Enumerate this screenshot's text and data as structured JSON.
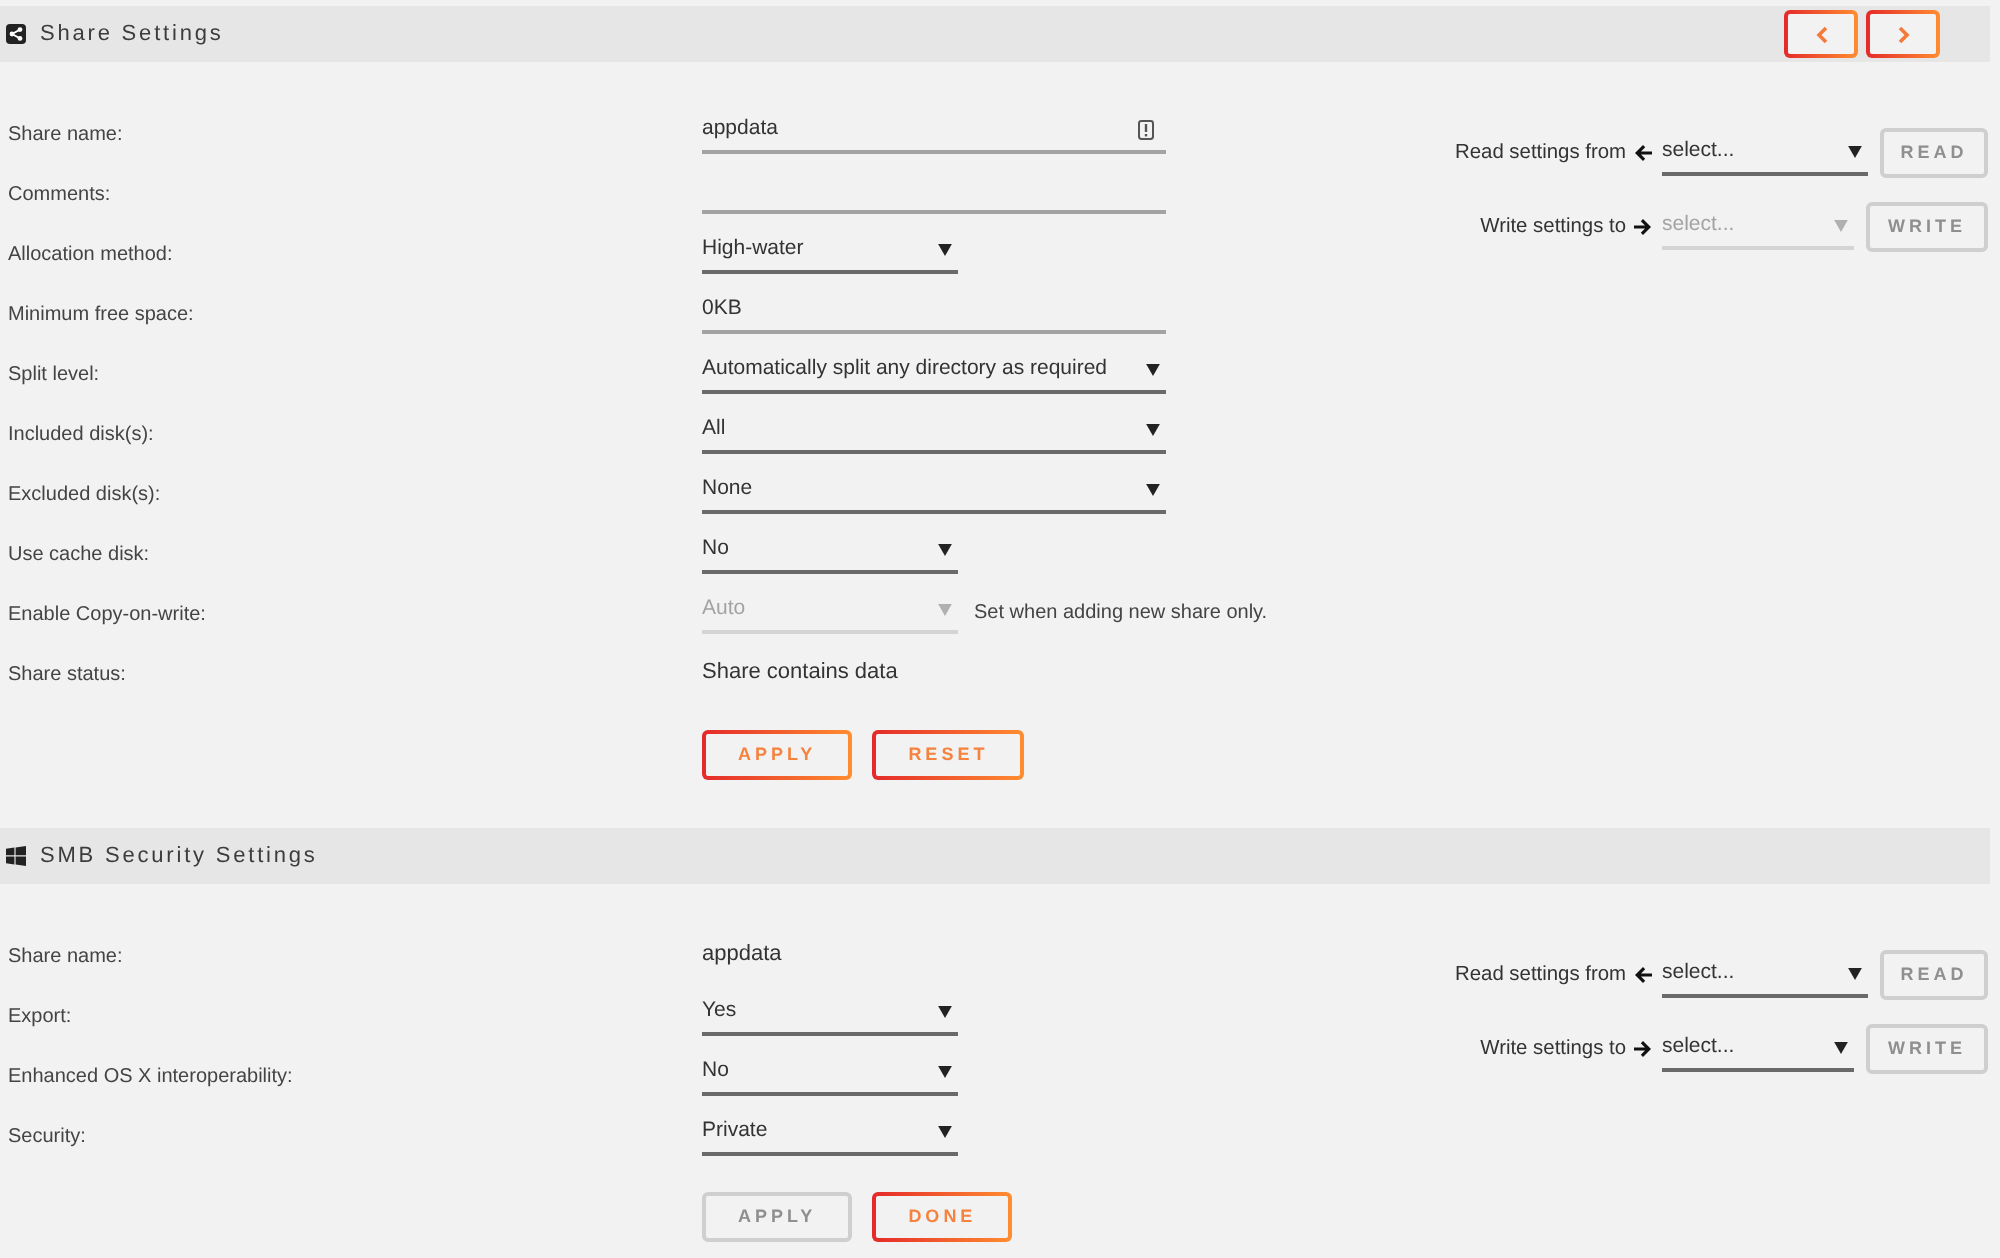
{
  "sections": [
    {
      "kind": "share",
      "title": "Share Settings",
      "nav_buttons": true,
      "fields": [
        {
          "kind": "input",
          "label": "Share name:",
          "value": "appdata",
          "hint_icon": true
        },
        {
          "kind": "input",
          "label": "Comments:",
          "hint_icon": false
        },
        {
          "kind": "select",
          "label": "Allocation method:",
          "value": "High-water",
          "disabled": false
        },
        {
          "kind": "input",
          "label": "Minimum free space:",
          "value": "0KB",
          "hint_icon": false
        },
        {
          "kind": "select",
          "label": "Split level:",
          "value": "Automatically split any directory as required",
          "disabled": false
        },
        {
          "kind": "select",
          "label": "Included disk(s):",
          "value": "All",
          "disabled": false
        },
        {
          "kind": "select",
          "label": "Excluded disk(s):",
          "value": "None",
          "disabled": false
        },
        {
          "kind": "select",
          "label": "Use cache disk:",
          "value": "No",
          "disabled": false
        },
        {
          "kind": "select",
          "label": "Enable Copy-on-write:",
          "value": "Auto",
          "disabled": true,
          "note": "Set when adding new share only."
        },
        {
          "kind": "text",
          "label": "Share status:",
          "value": "Share contains data"
        }
      ],
      "buttons": [
        {
          "label": "APPLY",
          "disabled": false
        },
        {
          "label": "RESET",
          "disabled": false
        }
      ],
      "copy_settings": [
        {
          "kind": "read",
          "label": "Read settings from",
          "select": {
            "value": "select...",
            "disabled": false
          },
          "button": {
            "label": "READ",
            "disabled": true
          }
        },
        {
          "kind": "write",
          "label": "Write settings to",
          "select": {
            "value": "select...",
            "disabled": true
          },
          "button": {
            "label": "WRITE",
            "disabled": true
          }
        }
      ]
    },
    {
      "kind": "smb",
      "title": "SMB Security Settings",
      "nav_buttons": false,
      "fields": [
        {
          "kind": "text",
          "label": "Share name:",
          "value": "appdata"
        },
        {
          "kind": "select",
          "label": "Export:",
          "value": "Yes",
          "disabled": false
        },
        {
          "kind": "select",
          "label": "Enhanced OS X interoperability:",
          "value": "No",
          "disabled": false
        },
        {
          "kind": "select",
          "label": "Security:",
          "value": "Private",
          "disabled": false
        }
      ],
      "buttons": [
        {
          "label": "APPLY",
          "disabled": true
        },
        {
          "label": "DONE",
          "disabled": false
        }
      ],
      "copy_settings": [
        {
          "kind": "read",
          "label": "Read settings from",
          "select": {
            "value": "select...",
            "disabled": false
          },
          "button": {
            "label": "READ",
            "disabled": true
          }
        },
        {
          "kind": "write",
          "label": "Write settings to",
          "select": {
            "value": "select...",
            "disabled": false
          },
          "button": {
            "label": "WRITE",
            "disabled": true
          }
        }
      ]
    }
  ]
}
